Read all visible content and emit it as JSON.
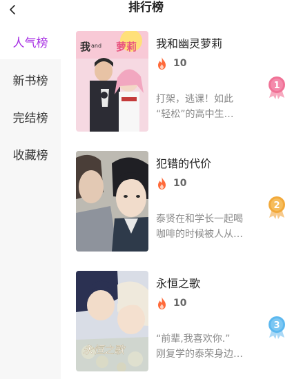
{
  "header": {
    "title": "排行榜",
    "back_icon": "chevron-left-icon"
  },
  "sidebar": {
    "items": [
      {
        "label": "人气榜",
        "active": true
      },
      {
        "label": "新书榜",
        "active": false
      },
      {
        "label": "完结榜",
        "active": false
      },
      {
        "label": "收藏榜",
        "active": false
      }
    ]
  },
  "colors": {
    "accent": "#a62de3",
    "flame": "#ff6a3a",
    "gold_medal": "#f2a93b",
    "silver_blue_medal": "#5cb8ef",
    "pink_medal": "#f07296"
  },
  "books": [
    {
      "rank": "1",
      "title": "我和幽灵萝莉",
      "heat": "10",
      "desc_line1": "打架，逃课！如此",
      "desc_line2": "“轻松”的高中生…",
      "cover_text": "我",
      "cover_text2": "and",
      "cover_text3": "萝莉"
    },
    {
      "rank": "2",
      "title": "犯错的代价",
      "heat": "10",
      "desc_line1": "泰贤在和学长一起喝",
      "desc_line2": "咖啡的时候被人从…"
    },
    {
      "rank": "3",
      "title": "永恒之歌",
      "heat": "10",
      "desc_line1": "“前辈,我喜欢你.”",
      "desc_line2": "刚复学的泰荣身边…",
      "cover_text": "永恒之歌"
    }
  ]
}
